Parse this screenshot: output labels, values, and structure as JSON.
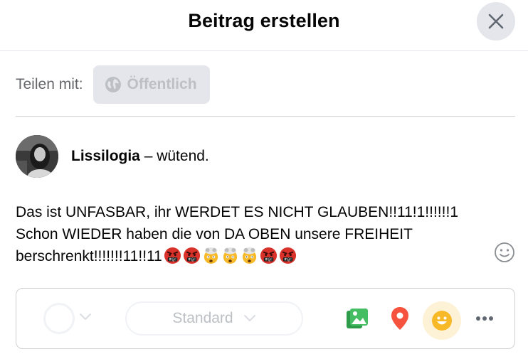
{
  "header": {
    "title": "Beitrag erstellen"
  },
  "share": {
    "label": "Teilen mit:",
    "audience": "Öffentlich"
  },
  "author": {
    "name": "Lissilogia",
    "status": " – wütend."
  },
  "post": {
    "text": "Das ist UNFASBAR, ihr WERDET ES NICHT GLAUBEN!!11!1!!!!!!1\nSchon WIEDER haben die von DA OBEN unsere FREIHEIT\nberschrenkt!!!!!!!11!!11",
    "emojis": [
      "angry-face-icon",
      "angry-face-icon",
      "exploding-head-icon",
      "exploding-head-icon",
      "exploding-head-icon",
      "angry-face-icon",
      "angry-face-icon"
    ]
  },
  "toolbar": {
    "style_label": "Standard"
  },
  "colors": {
    "close_bg": "#e4e6eb",
    "photo_green": "#45bd62",
    "location_red": "#f5533d",
    "feeling_yellow": "#f7b928"
  }
}
